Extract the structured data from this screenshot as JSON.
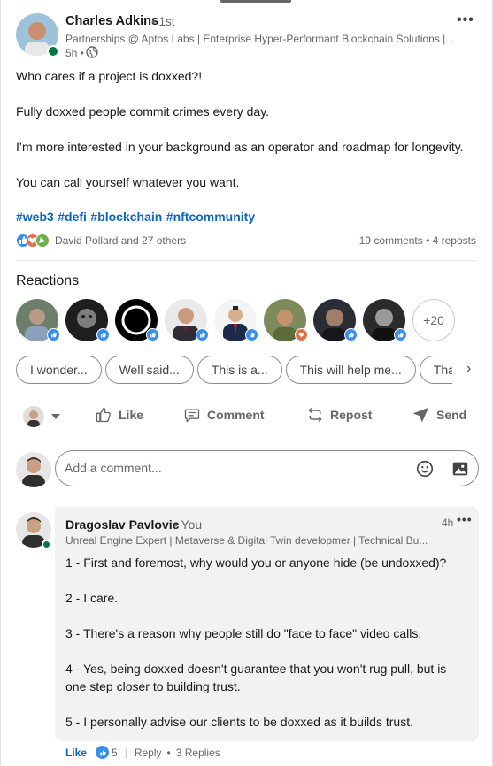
{
  "post": {
    "author_name": "Charles Adkins",
    "author_degree": "• 1st",
    "author_headline": "Partnerships @ Aptos Labs | Enterprise Hyper-Performant Blockchain Solutions |...",
    "time": "5h •",
    "more_icon": "•••",
    "paragraphs": [
      "Who cares if a project is doxxed?!",
      "Fully doxxed people commit crimes every day.",
      "I’m more interested in your background as an operator and roadmap for longevity.",
      "You can call yourself whatever you want."
    ],
    "hashtags": [
      "#web3",
      "#defi",
      "#blockchain",
      "#nftcommunity"
    ],
    "reaction_summary": "David Pollard and 27 others",
    "comments_reposts": "19 comments • 4 reposts"
  },
  "reactions": {
    "title": "Reactions",
    "more_count": "+20"
  },
  "suggestions": {
    "chips": [
      "I wonder...",
      "Well said...",
      "This is a...",
      "This will help me...",
      "Thanks"
    ],
    "next_icon": "›"
  },
  "actions": {
    "like": "Like",
    "comment": "Comment",
    "repost": "Repost",
    "send": "Send"
  },
  "composer": {
    "placeholder": "Add a comment..."
  },
  "comment": {
    "author_name": "Dragoslav Pavlovic",
    "author_tag": "• You",
    "author_headline": "Unreal Engine Expert | Metaverse & Digital Twin developmer | Technical Bu...",
    "time": "4h",
    "more_icon": "•••",
    "paragraphs": [
      "1 - First and foremost, why would you or anyone hide (be undoxxed)?",
      "2 - I care.",
      "3 - There's a reason why people still do \"face to face\" video calls.",
      "4 - Yes, being doxxed doesn't guarantee that you won't rug pull, but is one step closer to building trust.",
      "5 - I personally advise our clients to be doxxed as it builds trust."
    ],
    "footer": {
      "like": "Like",
      "like_count": "5",
      "reply": "Reply",
      "replies": "3 Replies"
    }
  },
  "colors": {
    "accent": "#0a66c2",
    "online": "#057642",
    "like_blue": "#378fe9",
    "love_red": "#df704d",
    "celebrate_green": "#6dae4f"
  }
}
